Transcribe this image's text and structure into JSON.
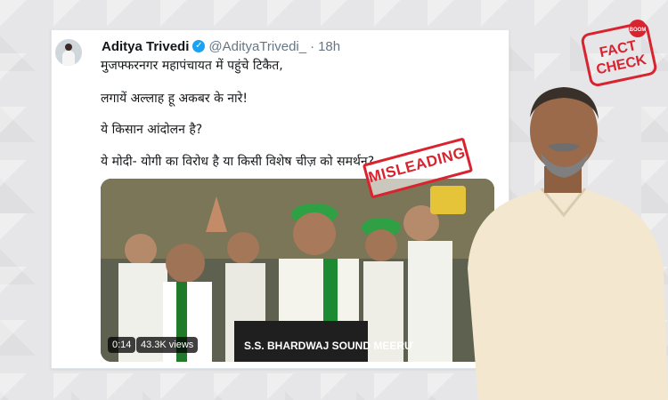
{
  "tweet": {
    "display_name": "Aditya Trivedi",
    "handle": "@AdityaTrivedi_",
    "separator": "·",
    "time": "18h",
    "lines": [
      "मुजफ्फरनगर महापंचायत में पहुंचे टिकैत,",
      "लगायें अल्लाह हू अकबर के नारे!",
      "ये किसान आंदोलन है?",
      "ये मोदी- योगी का विरोध है या किसी विशेष चीज़ को समर्थन?"
    ]
  },
  "video": {
    "duration": "0:14",
    "views": "43.3K views",
    "banner_text": "S.S. BHARDWAJ SOUND MEERUT"
  },
  "stamps": {
    "misleading": "MISLEADING",
    "fact_check_top": "FACT",
    "fact_check_bottom": "CHECK",
    "fact_check_tag": "BOOM"
  },
  "colors": {
    "stamp_red": "#d9232f",
    "verified_blue": "#1da1f2"
  },
  "icons": [
    "verified-badge-icon"
  ]
}
